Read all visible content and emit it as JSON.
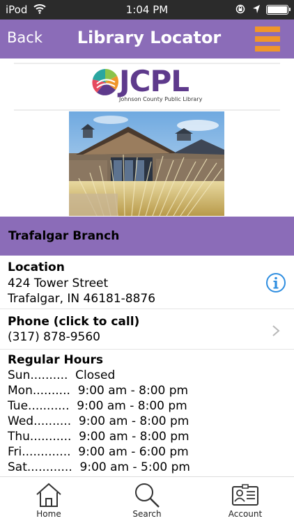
{
  "status_bar": {
    "carrier": "iPod",
    "time": "1:04 PM",
    "wifi_icon": "wifi-icon",
    "rotation_lock_icon": "rotation-lock-icon",
    "location_icon": "location-arrow-icon",
    "battery_icon": "battery-icon"
  },
  "nav": {
    "back_label": "Back",
    "title": "Library Locator",
    "menu_icon": "hamburger-menu-icon",
    "accent_color": "#8b6cb8",
    "menu_color": "#f0962a"
  },
  "logo": {
    "letters": "JCPL",
    "tagline": "Johnson County Public Library"
  },
  "branch": {
    "name": "Trafalgar Branch"
  },
  "location": {
    "heading": "Location",
    "address_line1": "424 Tower Street",
    "address_line2": "Trafalgar, IN 46181-8876",
    "icon": "info-icon"
  },
  "phone": {
    "heading": "Phone (click to call)",
    "number": "(317) 878-9560",
    "icon": "chevron-right-icon"
  },
  "hours": {
    "heading": "Regular Hours",
    "lines": [
      "Sun..........  Closed",
      "Mon..........  9:00 am - 8:00 pm",
      "Tue...........  9:00 am - 8:00 pm",
      "Wed..........  9:00 am - 8:00 pm",
      "Thu...........  9:00 am - 8:00 pm",
      "Fri.............  9:00 am - 6:00 pm",
      "Sat............  9:00 am - 5:00 pm"
    ]
  },
  "tabs": [
    {
      "label": "Home",
      "icon": "home-icon"
    },
    {
      "label": "Search",
      "icon": "search-icon"
    },
    {
      "label": "Account",
      "icon": "account-card-icon"
    }
  ]
}
